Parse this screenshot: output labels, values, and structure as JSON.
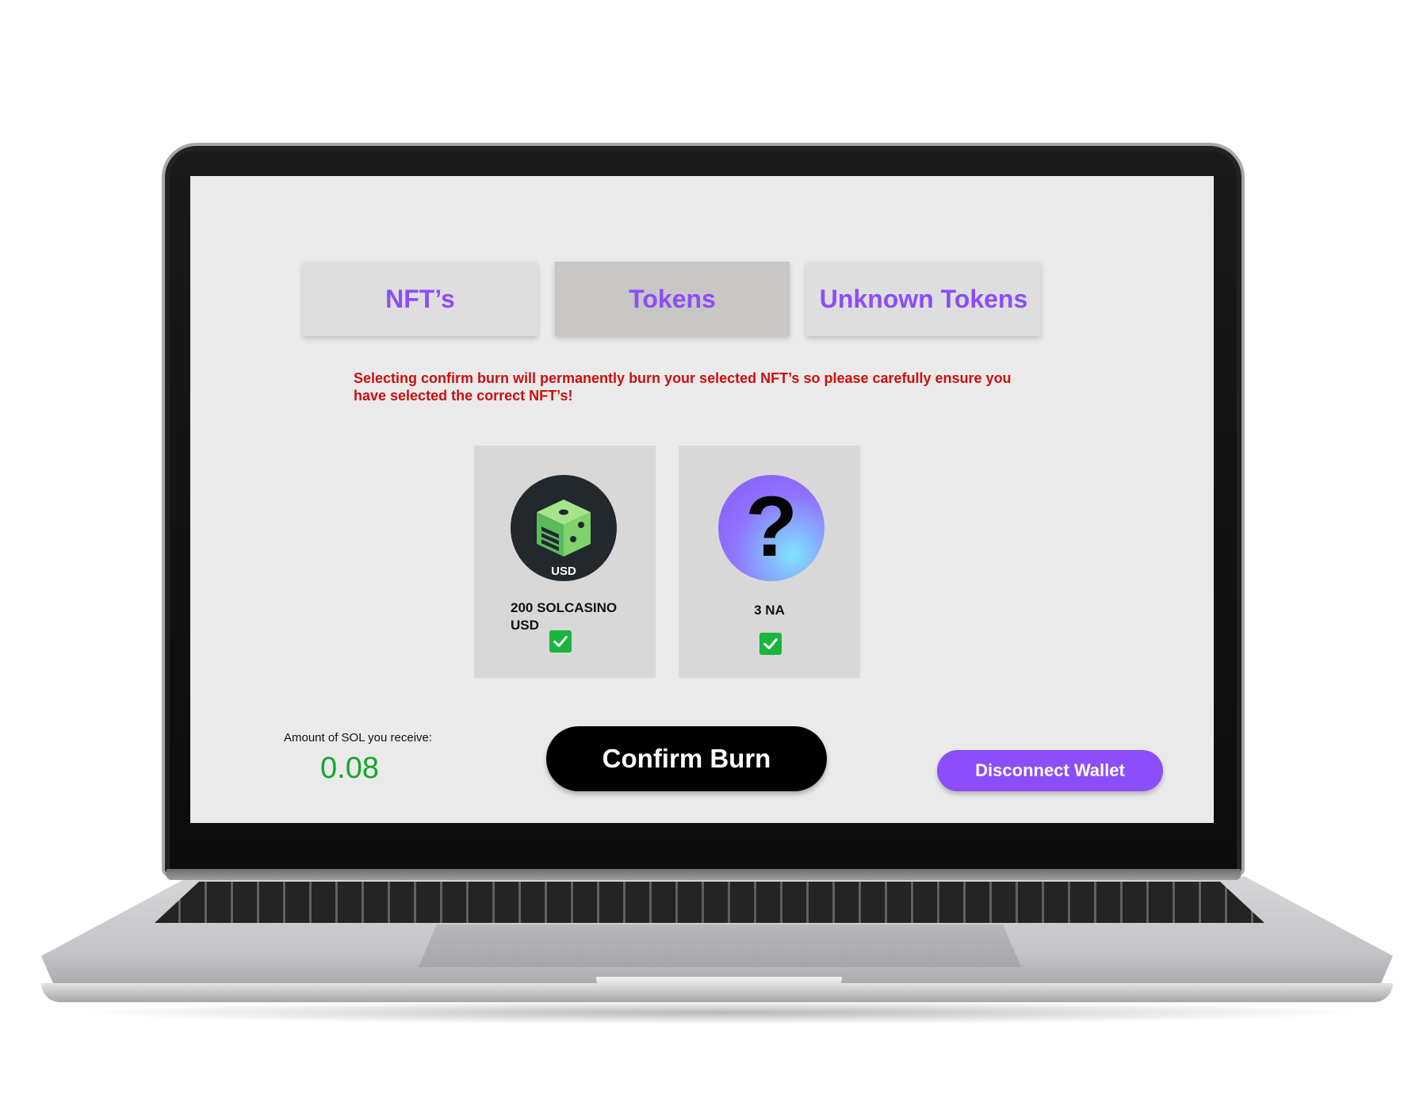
{
  "tabs": [
    {
      "label": "NFT’s",
      "active": false
    },
    {
      "label": "Tokens",
      "active": true
    },
    {
      "label": "Unknown Tokens",
      "active": false
    }
  ],
  "warning": {
    "text": "Selecting confirm burn will permanently burn your selected NFT’s so please carefully ensure you have selected the correct NFT’s!"
  },
  "tokens": [
    {
      "name": "200 SOLCASINO USD",
      "image_label": "USD",
      "icon": "dice-icon",
      "selected": true
    },
    {
      "name": "3 NA",
      "image_label": "?",
      "icon": "question-mark-icon",
      "selected": true
    }
  ],
  "summary": {
    "label": "Amount of SOL you receive:",
    "value": "0.08"
  },
  "buttons": {
    "confirm": "Confirm Burn",
    "disconnect": "Disconnect Wallet"
  },
  "colors": {
    "accent": "#8c4dfa",
    "warning": "#cc0f0f",
    "success": "#16a52b",
    "screen_bg": "#eaeaea"
  }
}
